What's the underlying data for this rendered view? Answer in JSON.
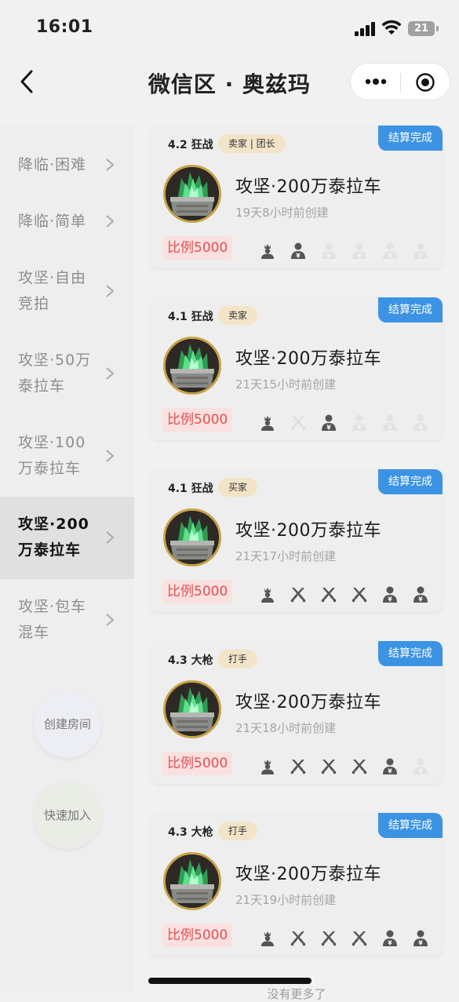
{
  "status_bar": {
    "time": "16:01",
    "battery": "21"
  },
  "nav": {
    "title": "微信区 · 奥兹玛"
  },
  "sidebar": {
    "items": [
      {
        "label": "降临·困难",
        "active": false
      },
      {
        "label": "降临·简单",
        "active": false
      },
      {
        "label": "攻坚·自由竞拍",
        "active": false
      },
      {
        "label": "攻坚·50万泰拉车",
        "active": false
      },
      {
        "label": "攻坚·100万泰拉车",
        "active": false
      },
      {
        "label": "攻坚·200万泰拉车",
        "active": true
      },
      {
        "label": "攻坚·包车混车",
        "active": false
      }
    ],
    "create_room": "创建房间",
    "quick_join": "快速加入"
  },
  "cards": [
    {
      "status": "结算完成",
      "level": "4.2 狂战",
      "role": "卖家 | 团长",
      "name": "攻坚·200万泰拉车",
      "created": "19天8小时前创建",
      "ratio": "比例5000",
      "slots": [
        "leader",
        "seller",
        "empty",
        "empty",
        "empty",
        "empty"
      ]
    },
    {
      "status": "结算完成",
      "level": "4.1 狂战",
      "role": "卖家",
      "name": "攻坚·200万泰拉车",
      "created": "21天15小时前创建",
      "ratio": "比例5000",
      "slots": [
        "leader",
        "empty-fighter",
        "seller",
        "empty",
        "empty",
        "empty"
      ]
    },
    {
      "status": "结算完成",
      "level": "4.1 狂战",
      "role": "买家",
      "name": "攻坚·200万泰拉车",
      "created": "21天17小时前创建",
      "ratio": "比例5000",
      "slots": [
        "leader",
        "fighter",
        "fighter",
        "fighter",
        "seller",
        "seller"
      ]
    },
    {
      "status": "结算完成",
      "level": "4.3 大枪",
      "role": "打手",
      "name": "攻坚·200万泰拉车",
      "created": "21天18小时前创建",
      "ratio": "比例5000",
      "slots": [
        "leader",
        "fighter",
        "fighter",
        "fighter",
        "seller",
        "empty"
      ]
    },
    {
      "status": "结算完成",
      "level": "4.3 大枪",
      "role": "打手",
      "name": "攻坚·200万泰拉车",
      "created": "21天19小时前创建",
      "ratio": "比例5000",
      "slots": [
        "leader",
        "fighter",
        "fighter",
        "fighter",
        "seller",
        "seller"
      ]
    }
  ],
  "footer": {
    "no_more": "没有更多了"
  },
  "colors": {
    "status_blue": "#3c93e4",
    "ratio_red": "#e05050",
    "avatar_border": "#c9a247",
    "role_tag": "#f3e4c8"
  },
  "icons": {
    "leader": "crown-person-icon",
    "seller": "yen-person-icon",
    "fighter": "crossed-swords-icon",
    "empty": "empty-seat-icon",
    "empty-fighter": "empty-swords-icon"
  }
}
